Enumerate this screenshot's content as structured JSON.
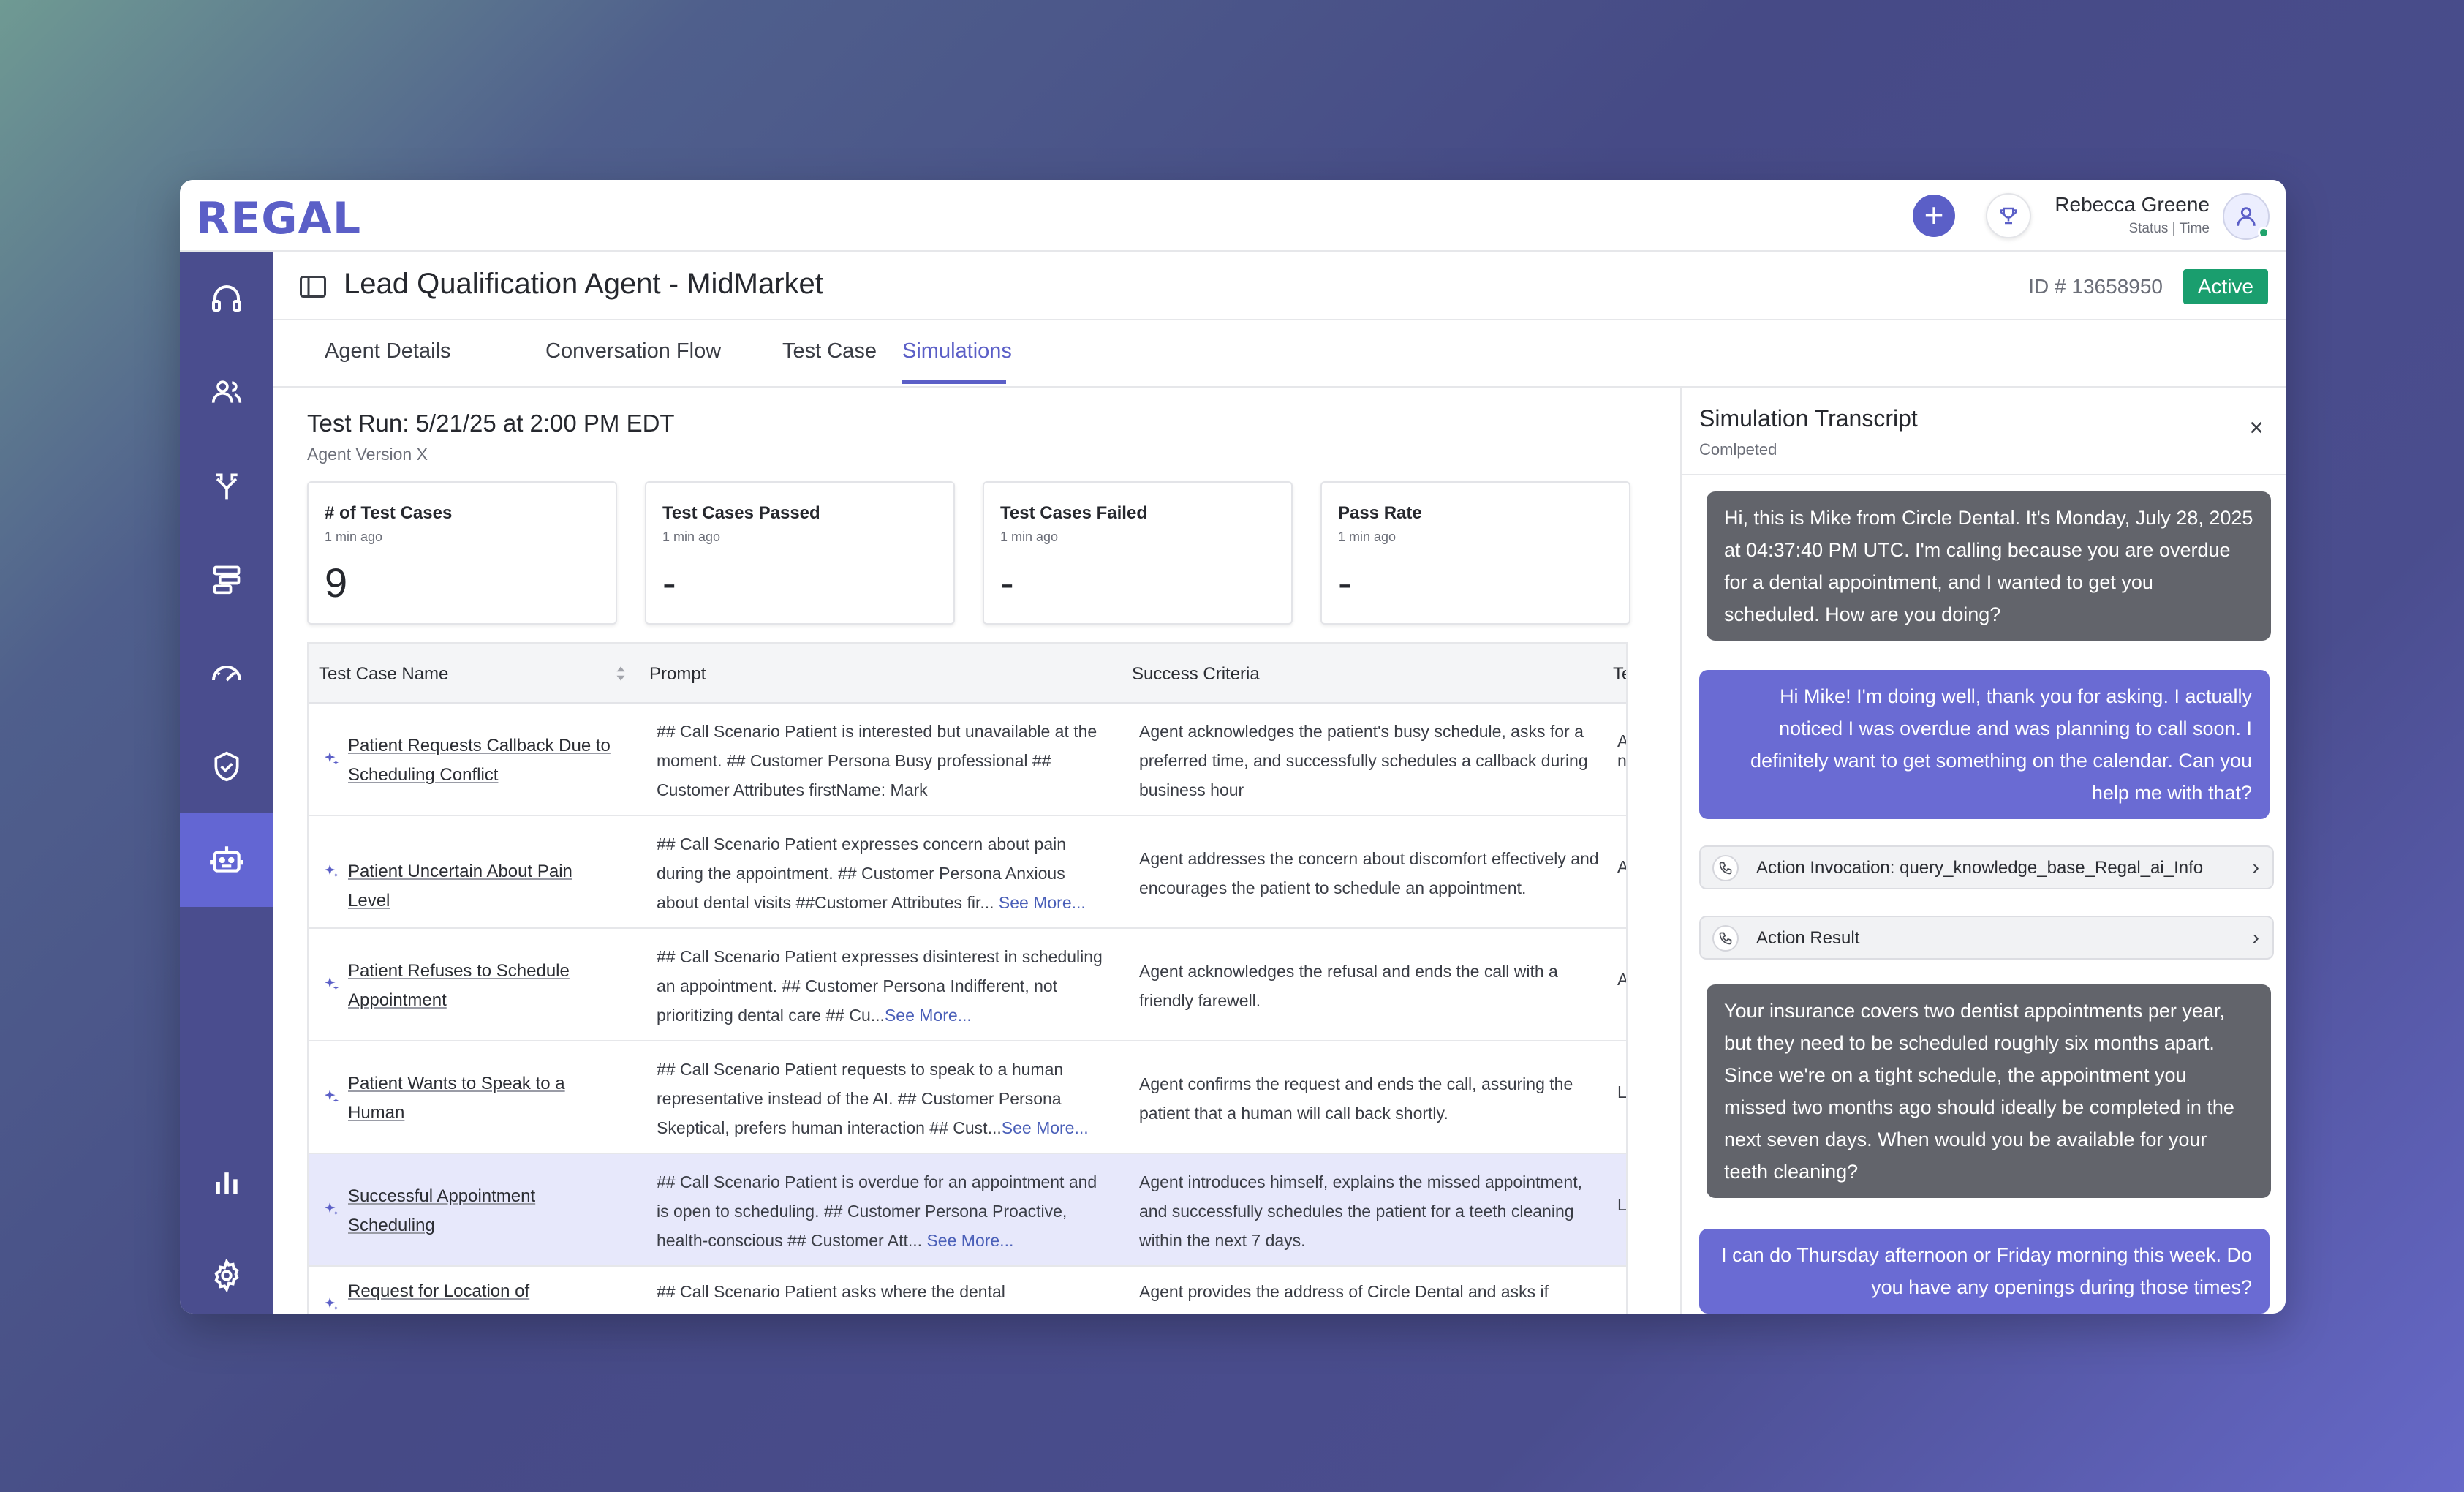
{
  "app": {
    "logo": "REGAL"
  },
  "topbar": {
    "user_name": "Rebecca Greene",
    "user_status": "Status | Time"
  },
  "header": {
    "title": "Lead Qualification Agent - MidMarket",
    "id_label": "ID # 13658950",
    "status": "Active"
  },
  "tabs": [
    {
      "label": "Agent Details",
      "active": false
    },
    {
      "label": "Conversation Flow",
      "active": false
    },
    {
      "label": "Test Case",
      "active": false
    },
    {
      "label": "Simulations",
      "active": true
    }
  ],
  "run": {
    "title": "Test Run: 5/21/25 at 2:00 PM EDT",
    "version": "Agent Version X"
  },
  "stats": [
    {
      "label": "# of Test Cases",
      "time": "1 min ago",
      "value": "9"
    },
    {
      "label": "Test Cases Passed",
      "time": "1 min ago",
      "value": "-"
    },
    {
      "label": "Test Cases Failed",
      "time": "1 min ago",
      "value": "-"
    },
    {
      "label": "Pass Rate",
      "time": "1 min ago",
      "value": "-"
    }
  ],
  "table": {
    "headers": {
      "name": "Test Case Name",
      "prompt": "Prompt",
      "criteria": "Success Criteria",
      "next": "Te"
    },
    "rows": [
      {
        "name": "Patient Requests Callback Due to Scheduling Conflict",
        "prompt": "## Call Scenario Patient is interested but unavailable at the moment. ## Customer Persona Busy professional ## Customer Attributes firstName: Mark",
        "see_more": "",
        "criteria": "Agent acknowledges the patient's busy schedule, asks for a preferred time, and successfully schedules a callback during business hour",
        "next": "A n"
      },
      {
        "name": "Patient Uncertain About Pain Level",
        "prompt": "## Call Scenario Patient expresses concern about pain during the appointment. ## Customer Persona Anxious about dental visits ##Customer Attributes fir...",
        "see_more": "See More...",
        "criteria": "Agent addresses the concern about discomfort effectively and encourages the patient to schedule an appointment.",
        "next": "A"
      },
      {
        "name": "Patient Refuses to Schedule Appointment",
        "prompt": "## Call Scenario Patient expresses disinterest in scheduling an appointment. ## Customer Persona Indifferent, not prioritizing dental care ## Cu...",
        "see_more": "See More...",
        "criteria": "Agent acknowledges the refusal and ends the call with a friendly farewell.",
        "next": "A"
      },
      {
        "name": "Patient Wants to Speak to a Human",
        "prompt": "## Call Scenario Patient requests to speak to a human representative instead of the AI. ## Customer Persona Skeptical, prefers human interaction ## Cust...",
        "see_more": "See More...",
        "criteria": "Agent confirms the request and ends the call, assuring the patient that a human will call back shortly.",
        "next": "L"
      },
      {
        "name": "Successful Appointment Scheduling",
        "prompt": "## Call Scenario Patient is overdue for an appointment and is open to scheduling. ## Customer Persona Proactive, health-conscious ## Customer Att...",
        "see_more": "See More...",
        "criteria": "Agent introduces himself, explains the missed appointment, and successfully schedules the patient for a teeth cleaning within the next 7 days.",
        "next": "L"
      },
      {
        "name": "Request for Location of",
        "prompt": "## Call Scenario Patient asks where the dental",
        "see_more": "",
        "criteria": "Agent provides the address of Circle Dental and asks if",
        "next": ""
      }
    ]
  },
  "transcript": {
    "title": "Simulation Transcript",
    "status": "Comlpeted",
    "close": "×",
    "messages": [
      {
        "role": "agent",
        "text": "Hi, this is Mike from Circle Dental. It's Monday, July 28, 2025 at 04:37:40 PM UTC. I'm calling because you are overdue for a dental appointment, and I wanted to get you scheduled. How are you doing?"
      },
      {
        "role": "user",
        "text": "Hi Mike! I'm doing well, thank you for asking. I actually noticed I was overdue and was planning to call soon. I definitely want to get something on the calendar. Can you help me with that?"
      },
      {
        "role": "action",
        "text": "Action Invocation: query_knowledge_base_Regal_ai_Info"
      },
      {
        "role": "action",
        "text": "Action Result"
      },
      {
        "role": "agent",
        "text": "Your insurance covers two dentist appointments per year, but they need to be scheduled roughly six months apart. Since we're on a tight schedule, the appointment you missed two months ago should ideally be completed in the next seven days. When would you be available for your teeth cleaning?"
      },
      {
        "role": "user",
        "text": "I can do Thursday afternoon or Friday morning this week. Do you have any openings during those times?"
      }
    ]
  },
  "colors": {
    "brand": "#5b5fc7",
    "sidebar": "#4a4d8e",
    "active_badge": "#1a9e6e",
    "agent_bubble": "#62646b",
    "user_bubble": "#6a6bd3"
  }
}
